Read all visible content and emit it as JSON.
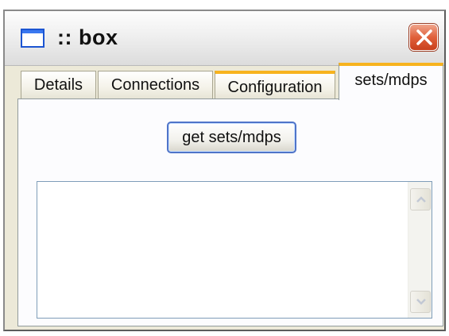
{
  "window": {
    "title": ":: box",
    "app_icon": "window-icon",
    "close_icon": "close-icon"
  },
  "tabs": [
    {
      "label": "Details",
      "active": false
    },
    {
      "label": "Connections",
      "active": false
    },
    {
      "label": "Configuration",
      "active": false
    },
    {
      "label": "sets/mdps",
      "active": true
    }
  ],
  "panel": {
    "get_button_label": "get sets/mdps",
    "output_text": ""
  },
  "scrollbar": {
    "up_icon": "scroll-up-arrow-icon",
    "down_icon": "scroll-down-arrow-icon"
  },
  "colors": {
    "tab_highlight": "#f7b31e",
    "button_border": "#4f74c9",
    "close_button": "#e0603b",
    "window_bg": "#ece9d8"
  }
}
